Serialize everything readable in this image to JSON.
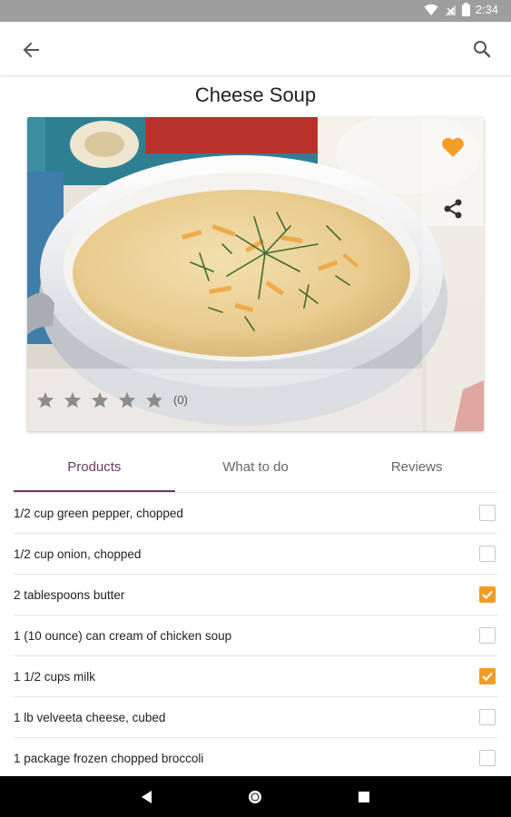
{
  "status_bar": {
    "time": "2:34"
  },
  "recipe": {
    "title": "Cheese Soup",
    "rating_count": "(0)",
    "stars_filled": 0,
    "stars_total": 5,
    "favorited": true
  },
  "tabs": [
    {
      "label": "Products",
      "active": true
    },
    {
      "label": "What to do",
      "active": false
    },
    {
      "label": "Reviews",
      "active": false
    }
  ],
  "ingredients": [
    {
      "label": "1/2 cup green pepper, chopped",
      "checked": false
    },
    {
      "label": "1/2 cup onion, chopped",
      "checked": false
    },
    {
      "label": "2 tablespoons butter",
      "checked": true
    },
    {
      "label": "1 (10 ounce) can cream of chicken soup",
      "checked": false
    },
    {
      "label": "1 1/2 cups milk",
      "checked": true
    },
    {
      "label": "1 lb velveeta cheese, cubed",
      "checked": false
    },
    {
      "label": "1 package frozen chopped broccoli",
      "checked": false
    }
  ],
  "colors": {
    "accent": "#f39c26",
    "tab_active": "#6b3a66",
    "status_bar": "#9e9e9e"
  }
}
